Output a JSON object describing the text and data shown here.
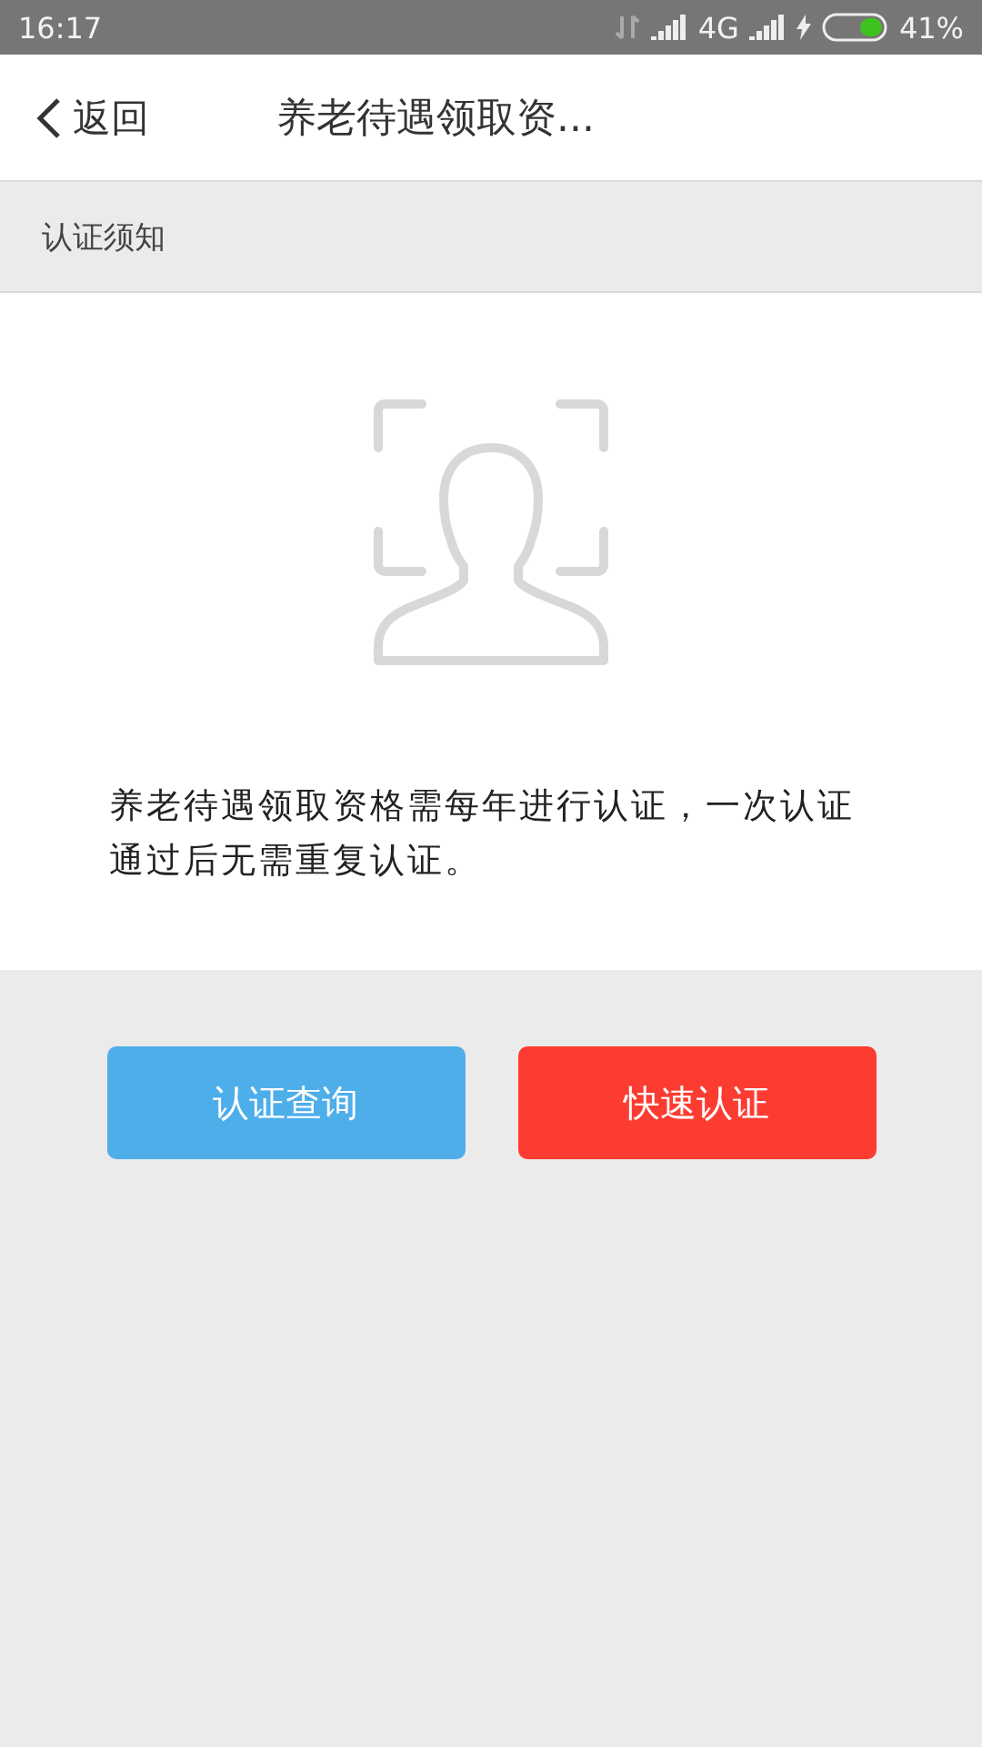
{
  "status_bar": {
    "time": "16:17",
    "network": "4G",
    "battery": "41%"
  },
  "header": {
    "back": "返回",
    "title": "养老待遇领取资..."
  },
  "section": {
    "title": "认证须知"
  },
  "notice": "养老待遇领取资格需每年进行认证，一次认证通过后无需重复认证。",
  "buttons": [
    {
      "label": "认证查询",
      "kind": "secondary"
    },
    {
      "label": "快速认证",
      "kind": "primary"
    }
  ]
}
